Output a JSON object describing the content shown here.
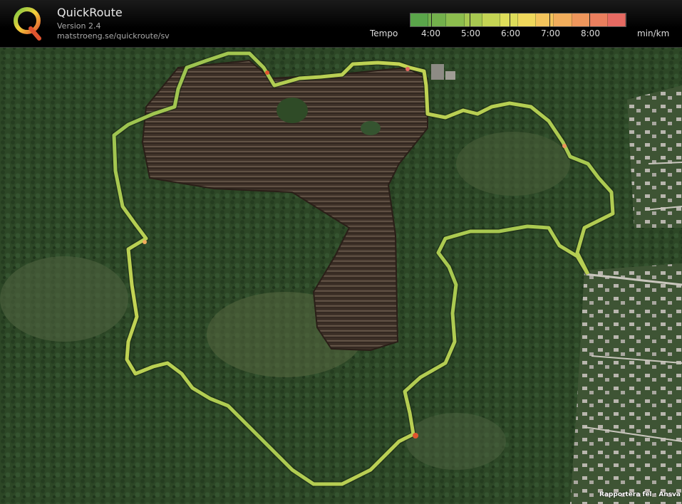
{
  "app": {
    "title": "QuickRoute",
    "version": "Version 2.4",
    "url": "matstroeng.se/quickroute/sv"
  },
  "legend": {
    "label": "Tempo",
    "ticks": [
      "4:00",
      "5:00",
      "6:00",
      "7:00",
      "8:00"
    ],
    "unit": "min/km",
    "colors": [
      "#5aa54a",
      "#73b04c",
      "#8cbd4e",
      "#a7c850",
      "#c4d454",
      "#dedd5a",
      "#efd85c",
      "#f3c45c",
      "#f1ad5c",
      "#ee965c",
      "#ea7f5e",
      "#e66a62"
    ]
  },
  "map": {
    "footer_link": "Rapportera fel · Ansva"
  }
}
